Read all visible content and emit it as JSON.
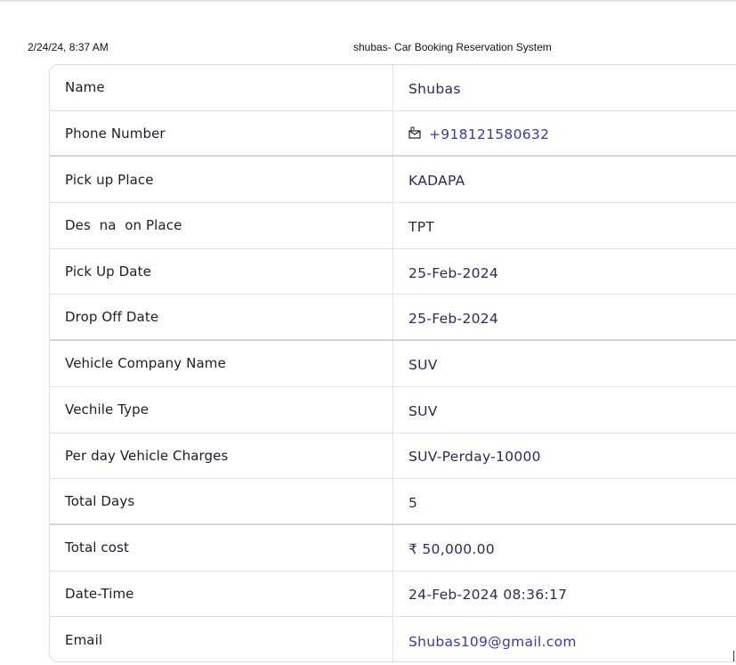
{
  "header": {
    "date": "2/24/24, 8:37 AM",
    "title": "shubas- Car Booking Reservation System"
  },
  "rows": [
    {
      "label": "Name",
      "value": "Shubas"
    },
    {
      "label": "Phone Number",
      "value": "+918121580632"
    },
    {
      "label": "Pick up Place",
      "value": "KADAPA"
    },
    {
      "label": "Des  na  on Place",
      "value": "TPT"
    },
    {
      "label": "Pick Up Date",
      "value": "25-Feb-2024"
    },
    {
      "label": "Drop Off Date",
      "value": "25-Feb-2024"
    },
    {
      "label": "Vehicle Company Name",
      "value": "SUV"
    },
    {
      "label": "Vechile Type",
      "value": "SUV"
    },
    {
      "label": "Per day Vehicle Charges",
      "value": "SUV-Perday-10000"
    },
    {
      "label": "Total Days",
      "value": "5"
    },
    {
      "label": "Total cost",
      "value": "₹ 50,000.00"
    },
    {
      "label": "Date-Time",
      "value": "24-Feb-2024 08:36:17"
    },
    {
      "label": "Email",
      "value": "Shubas109@gmail.com"
    }
  ]
}
